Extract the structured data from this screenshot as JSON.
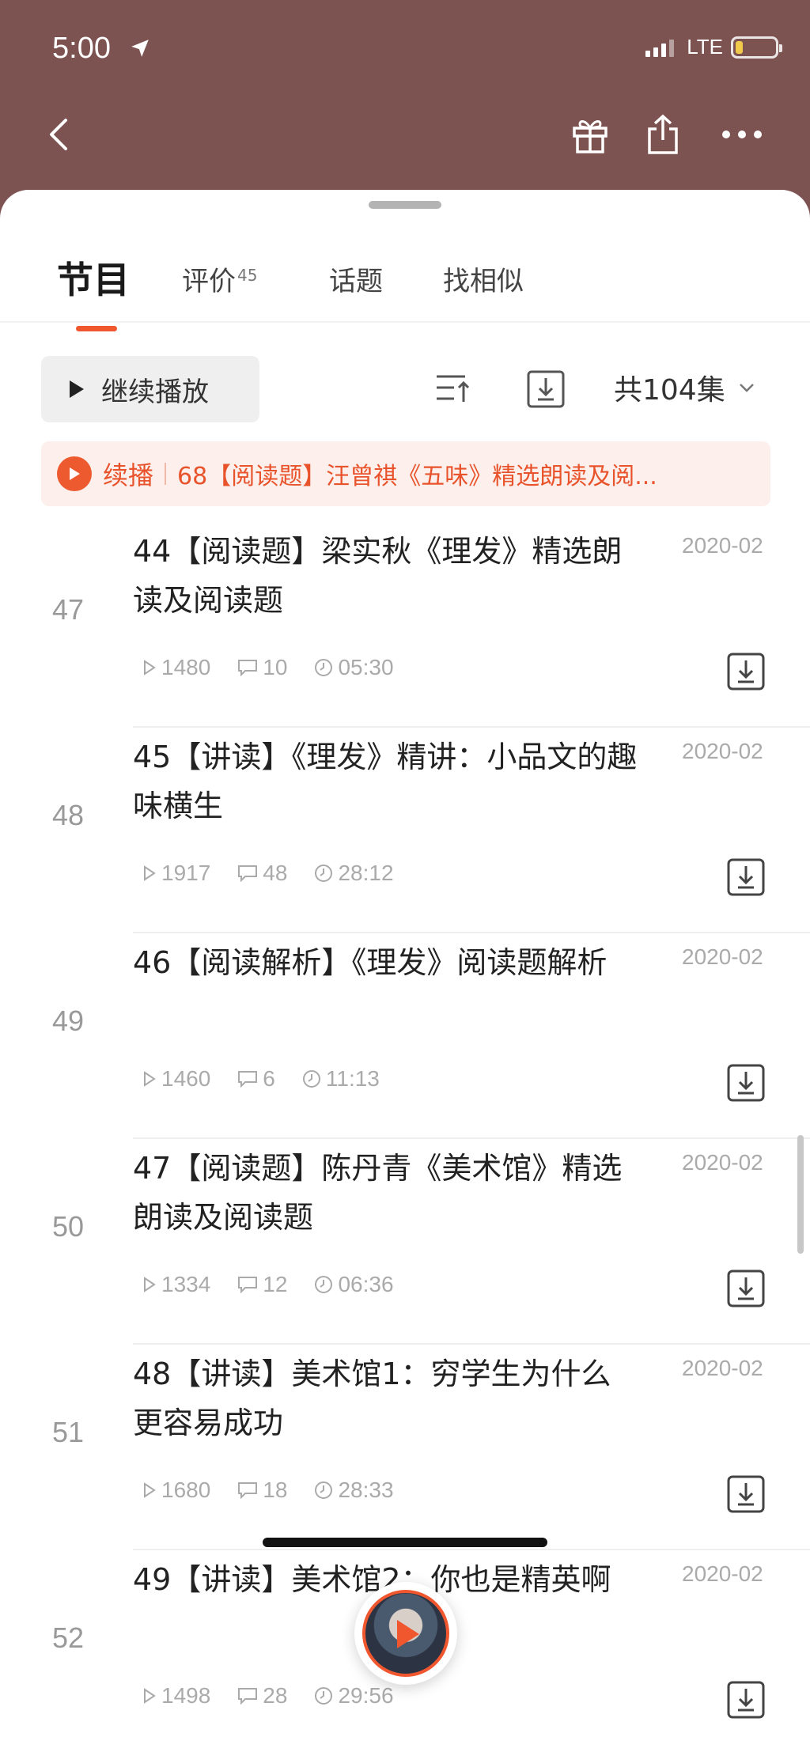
{
  "status": {
    "time": "5:00",
    "network": "LTE"
  },
  "tabs": [
    {
      "label": "节目"
    },
    {
      "label": "评价",
      "count": "45"
    },
    {
      "label": "话题"
    },
    {
      "label": "找相似"
    }
  ],
  "toolbar": {
    "continue_label": "继续播放",
    "episode_count": "共104集"
  },
  "resume": {
    "label": "续播",
    "title": "68【阅读题】汪曾祺《五味》精选朗读及阅..."
  },
  "episodes": [
    {
      "index": "47",
      "title": "44【阅读题】梁实秋《理发》精选朗读及阅读题",
      "date": "2020-02",
      "plays": "1480",
      "comments": "10",
      "duration": "05:30"
    },
    {
      "index": "48",
      "title": "45【讲读】《理发》精讲：小品文的趣味横生",
      "date": "2020-02",
      "plays": "1917",
      "comments": "48",
      "duration": "28:12"
    },
    {
      "index": "49",
      "title": "46【阅读解析】《理发》阅读题解析",
      "date": "2020-02",
      "plays": "1460",
      "comments": "6",
      "duration": "11:13"
    },
    {
      "index": "50",
      "title": "47【阅读题】陈丹青《美术馆》精选朗读及阅读题",
      "date": "2020-02",
      "plays": "1334",
      "comments": "12",
      "duration": "06:36"
    },
    {
      "index": "51",
      "title": "48【讲读】美术馆1：穷学生为什么更容易成功",
      "date": "2020-02",
      "plays": "1680",
      "comments": "18",
      "duration": "28:33"
    },
    {
      "index": "52",
      "title": "49【讲读】美术馆2：你也是精英啊",
      "date": "2020-02",
      "plays": "1498",
      "comments": "28",
      "duration": "29:56"
    }
  ],
  "colors": {
    "accent": "#f0572f",
    "header_bg": "#7d5352"
  }
}
